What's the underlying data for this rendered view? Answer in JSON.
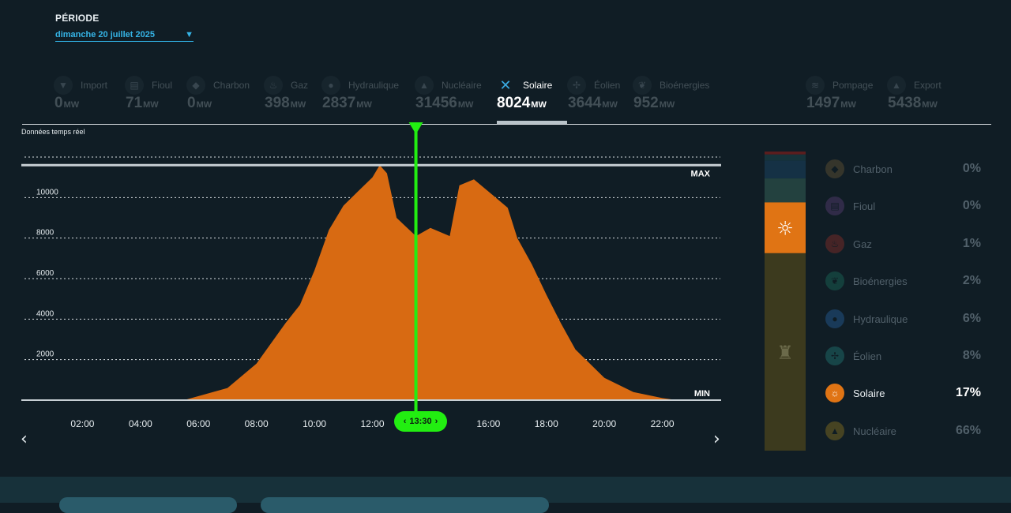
{
  "period": {
    "label": "PÉRIODE",
    "value": "dimanche 20 juillet 2025",
    "chevron_icon": "chevron-down-icon"
  },
  "tabs": [
    {
      "name": "Import",
      "value": "0",
      "unit": "MW",
      "icon": "import-icon",
      "active": false
    },
    {
      "name": "Fioul",
      "value": "71",
      "unit": "MW",
      "icon": "oil-barrel-icon",
      "active": false
    },
    {
      "name": "Charbon",
      "value": "0",
      "unit": "MW",
      "icon": "coal-icon",
      "active": false
    },
    {
      "name": "Gaz",
      "value": "398",
      "unit": "MW",
      "icon": "flame-icon",
      "active": false
    },
    {
      "name": "Hydraulique",
      "value": "2837",
      "unit": "MW",
      "icon": "water-drop-icon",
      "active": false
    },
    {
      "name": "Nucléaire",
      "value": "31456",
      "unit": "MW",
      "icon": "nuclear-icon",
      "active": false
    },
    {
      "name": "Solaire",
      "value": "8024",
      "unit": "MW",
      "icon": "close-icon",
      "active": true
    },
    {
      "name": "Éolien",
      "value": "3644",
      "unit": "MW",
      "icon": "wind-turbine-icon",
      "active": false
    },
    {
      "name": "Bioénergies",
      "value": "952",
      "unit": "MW",
      "icon": "leaf-icon",
      "active": false
    },
    {
      "name": "Pompage",
      "value": "1497",
      "unit": "MW",
      "icon": "pumping-icon",
      "active": false
    },
    {
      "name": "Export",
      "value": "5438",
      "unit": "MW",
      "icon": "export-icon",
      "active": false
    }
  ],
  "realtime_label": "Données temps réel",
  "cursor": {
    "time": "13:30",
    "left_icon": "chevron-left-icon",
    "right_icon": "chevron-right-icon"
  },
  "nav": {
    "prev": "‹",
    "next": "›"
  },
  "chart_data": {
    "type": "area",
    "series": [
      {
        "color": "#d86a12",
        "points": [
          [
            "05:30",
            0
          ],
          [
            "06:00",
            200
          ],
          [
            "07:00",
            600
          ],
          [
            "08:00",
            1800
          ],
          [
            "09:00",
            3800
          ],
          [
            "09:30",
            4700
          ],
          [
            "10:00",
            6400
          ],
          [
            "10:30",
            8400
          ],
          [
            "11:00",
            9600
          ],
          [
            "11:30",
            10300
          ],
          [
            "12:00",
            11000
          ],
          [
            "12:15",
            11600
          ],
          [
            "12:30",
            11200
          ],
          [
            "12:50",
            9000
          ],
          [
            "13:30",
            8100
          ],
          [
            "14:00",
            8500
          ],
          [
            "14:40",
            8100
          ],
          [
            "15:00",
            10600
          ],
          [
            "15:30",
            10900
          ],
          [
            "16:10",
            10100
          ],
          [
            "16:40",
            9500
          ],
          [
            "17:00",
            8000
          ],
          [
            "17:30",
            6700
          ],
          [
            "18:00",
            5200
          ],
          [
            "18:30",
            3800
          ],
          [
            "19:00",
            2500
          ],
          [
            "20:00",
            1100
          ],
          [
            "21:00",
            400
          ],
          [
            "22:00",
            100
          ],
          [
            "22:30",
            0
          ]
        ]
      }
    ],
    "x_ticks": [
      "02:00",
      "04:00",
      "06:00",
      "08:00",
      "10:00",
      "12:00",
      "14:00",
      "16:00",
      "18:00",
      "20:00",
      "22:00"
    ],
    "xlim": [
      "00:00",
      "24:00"
    ],
    "y_ticks": [
      2000,
      4000,
      6000,
      8000,
      10000
    ],
    "ylim": [
      0,
      12000
    ],
    "max_value": 11600,
    "max_label": "MAX",
    "min_value": 0,
    "min_label": "MIN",
    "cursor_time": "13:30",
    "grid": true
  },
  "mix_bar": {
    "segments": [
      {
        "name": "Gaz",
        "value": 1,
        "color": "#5a1e1e"
      },
      {
        "name": "Bioénergies",
        "value": 2,
        "color": "#16333a"
      },
      {
        "name": "Hydraulique",
        "value": 6,
        "color": "#153145"
      },
      {
        "name": "Éolien",
        "value": 8,
        "color": "#23413f"
      },
      {
        "name": "Solaire",
        "value": 17,
        "color": "#e07414",
        "icon": "sun-icon"
      },
      {
        "name": "Nucléaire",
        "value": 66,
        "color": "#3c3a1e",
        "icon": "nuclear-plant-icon"
      }
    ]
  },
  "legend": [
    {
      "name": "Charbon",
      "pct": "0%",
      "color": "#8b6e3a",
      "icon": "coal-icon",
      "active": false
    },
    {
      "name": "Fioul",
      "pct": "0%",
      "color": "#7a4b9a",
      "icon": "oil-barrel-icon",
      "active": false
    },
    {
      "name": "Gaz",
      "pct": "1%",
      "color": "#c2352b",
      "icon": "flame-icon",
      "active": false
    },
    {
      "name": "Bioénergies",
      "pct": "2%",
      "color": "#1e8f72",
      "icon": "leaf-icon",
      "active": false
    },
    {
      "name": "Hydraulique",
      "pct": "6%",
      "color": "#2f7dd0",
      "icon": "water-drop-icon",
      "active": false
    },
    {
      "name": "Éolien",
      "pct": "8%",
      "color": "#2aa39a",
      "icon": "wind-turbine-icon",
      "active": false
    },
    {
      "name": "Solaire",
      "pct": "17%",
      "color": "#e07414",
      "icon": "sun-icon",
      "active": true
    },
    {
      "name": "Nucléaire",
      "pct": "66%",
      "color": "#c39a1e",
      "icon": "nuclear-icon",
      "active": false
    }
  ]
}
